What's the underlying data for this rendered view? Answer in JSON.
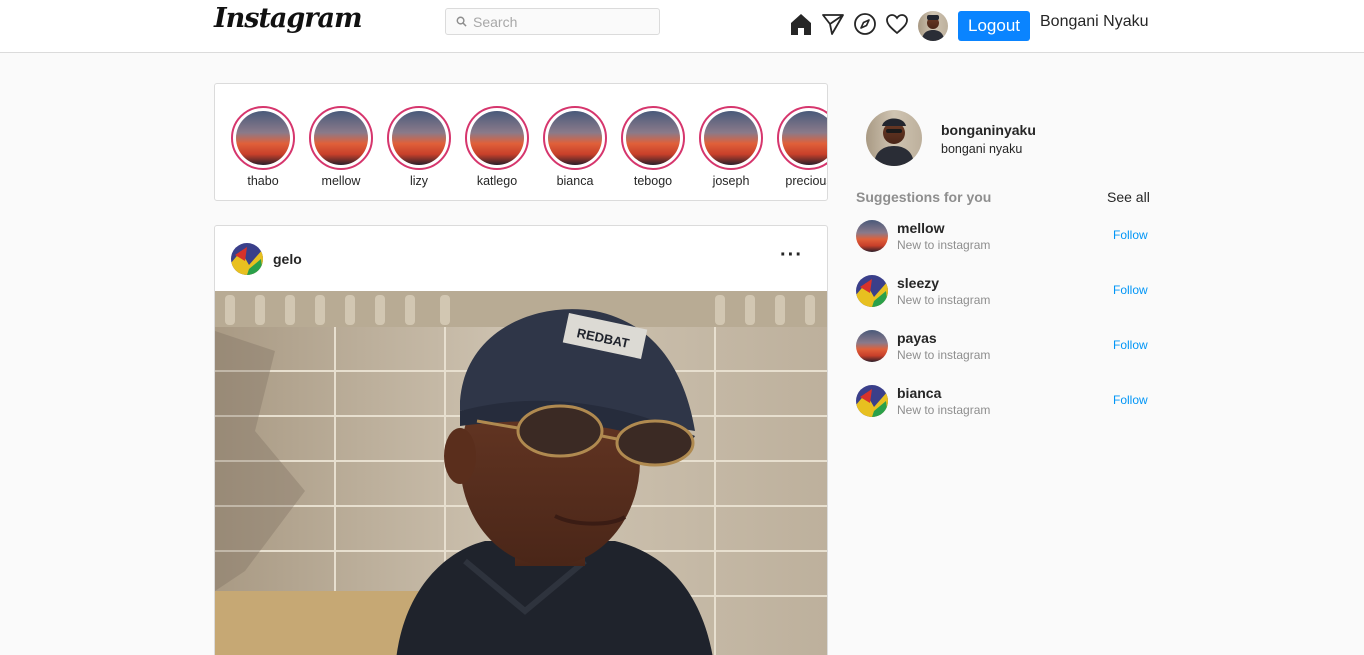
{
  "nav": {
    "logo": "Instagram",
    "search_placeholder": "Search",
    "icons": [
      "home-icon",
      "direct-send-icon",
      "explore-compass-icon",
      "heart-icon"
    ],
    "logout_label": "Logout",
    "username": "Bongani Nyaku"
  },
  "stories": [
    {
      "name": "thabo"
    },
    {
      "name": "mellow"
    },
    {
      "name": "lizy"
    },
    {
      "name": "katlego"
    },
    {
      "name": "bianca"
    },
    {
      "name": "tebogo"
    },
    {
      "name": "joseph"
    },
    {
      "name": "precious"
    }
  ],
  "post": {
    "username": "gelo",
    "more_label": "···",
    "cap_text": "REDBAT"
  },
  "sidebar": {
    "username": "bonganinyaku",
    "full_name": "bongani nyaku",
    "suggestions_title": "Suggestions for you",
    "see_all_label": "See all",
    "suggestions": [
      {
        "username": "mellow",
        "subtitle": "New to instagram",
        "follow_label": "Follow"
      },
      {
        "username": "sleezy",
        "subtitle": "New to instagram",
        "follow_label": "Follow"
      },
      {
        "username": "payas",
        "subtitle": "New to instagram",
        "follow_label": "Follow"
      },
      {
        "username": "bianca",
        "subtitle": "New to instagram",
        "follow_label": "Follow"
      }
    ]
  },
  "colors": {
    "accent_blue": "#0a84ff",
    "follow_blue": "#0095f6",
    "story_ring": "#d6366d",
    "border": "#dbdbdb",
    "background": "#fafafa"
  }
}
